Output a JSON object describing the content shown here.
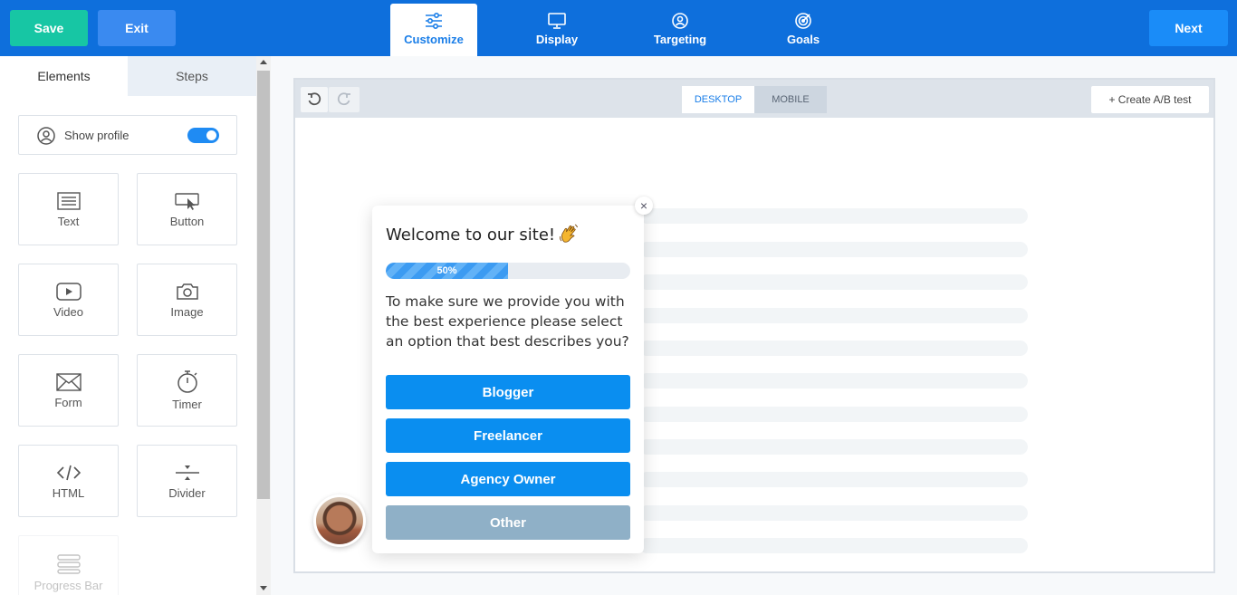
{
  "topbar": {
    "save_label": "Save",
    "exit_label": "Exit",
    "next_label": "Next",
    "tabs": [
      {
        "label": "Customize",
        "icon": "sliders-icon",
        "active": true
      },
      {
        "label": "Display",
        "icon": "monitor-icon",
        "active": false
      },
      {
        "label": "Targeting",
        "icon": "target-user-icon",
        "active": false
      },
      {
        "label": "Goals",
        "icon": "goal-target-icon",
        "active": false
      }
    ]
  },
  "sidebar": {
    "tabs": [
      {
        "label": "Elements",
        "active": true
      },
      {
        "label": "Steps",
        "active": false
      }
    ],
    "show_profile": {
      "label": "Show profile",
      "enabled": true
    },
    "elements": [
      {
        "label": "Text",
        "icon": "text-icon"
      },
      {
        "label": "Button",
        "icon": "button-cursor-icon"
      },
      {
        "label": "Video",
        "icon": "video-icon"
      },
      {
        "label": "Image",
        "icon": "camera-icon"
      },
      {
        "label": "Form",
        "icon": "envelope-icon"
      },
      {
        "label": "Timer",
        "icon": "stopwatch-icon"
      },
      {
        "label": "HTML",
        "icon": "code-icon"
      },
      {
        "label": "Divider",
        "icon": "divider-icon"
      },
      {
        "label": "Progress Bar",
        "icon": "progress-bar-icon"
      }
    ]
  },
  "canvas": {
    "device_tabs": [
      {
        "label": "DESKTOP",
        "active": true
      },
      {
        "label": "MOBILE",
        "active": false
      }
    ],
    "ab_test_label": "+ Create A/B test"
  },
  "popup": {
    "title": "Welcome to our site!",
    "close_symbol": "×",
    "progress": {
      "value": 50,
      "label": "50%"
    },
    "question": "To make sure we provide you with the best experience please select an option that best describes you?",
    "options": [
      "Blogger",
      "Freelancer",
      "Agency Owner",
      "Other"
    ]
  },
  "colors": {
    "topbar": "#0e6fdc",
    "save": "#17c6a4",
    "accent": "#1a8cf8",
    "option_button": "#0a8ef0",
    "option_other": "#8fb0c7"
  }
}
